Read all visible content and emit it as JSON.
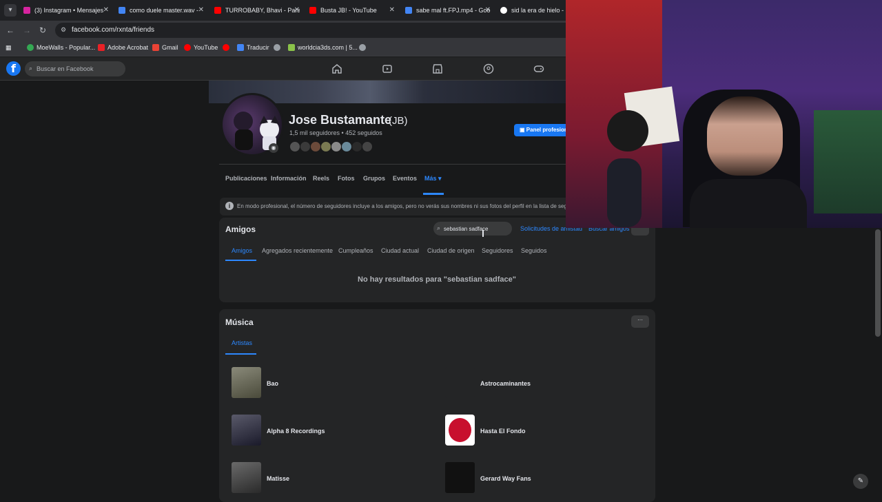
{
  "browser": {
    "tabs": [
      {
        "label": "(3) Instagram • Mensajes",
        "color": "#d6249f"
      },
      {
        "label": "como duele master.wav -",
        "color": "#4285f4"
      },
      {
        "label": "TURROBABY, Bhavi - Para",
        "color": "#ff0000"
      },
      {
        "label": "Busta JB! - YouTube",
        "color": "#ff0000"
      },
      {
        "label": "sabe mal ft.FPJ.mp4 - Goo",
        "color": "#4285f4"
      },
      {
        "label": "sid la era de hielo - Bu",
        "color": "#ffffff"
      }
    ],
    "url": "facebook.com/rxnta/friends",
    "bookmarks": [
      {
        "label": "MoeWalls - Popular...",
        "color": "#34a853"
      },
      {
        "label": "Adobe Acrobat",
        "color": "#ea2126"
      },
      {
        "label": "Gmail",
        "color": "#ea4335"
      },
      {
        "label": "YouTube",
        "color": "#ff0000"
      },
      {
        "label": "",
        "color": "#ff0000"
      },
      {
        "label": "Traducir",
        "color": "#4285f4"
      },
      {
        "label": "",
        "color": "#9aa0a6"
      },
      {
        "label": "worldcia3ds.com | 5...",
        "color": "#8bc34a"
      },
      {
        "label": "",
        "color": "#9aa0a6"
      }
    ]
  },
  "facebook": {
    "logo": "f",
    "search_placeholder": "Buscar en Facebook",
    "nav_icons": [
      "home-icon",
      "video-icon",
      "marketplace-icon",
      "groups-icon",
      "gaming-icon"
    ]
  },
  "profile": {
    "name": "Jose Bustamante",
    "alt_name": "(JB)",
    "stats": "1,5 mil seguidores • 452 seguidos",
    "panel_button": "Panel profesional",
    "tabs": [
      "Publicaciones",
      "Información",
      "Reels",
      "Fotos",
      "Grupos",
      "Eventos",
      "Más ▾"
    ],
    "active_tab": "Más ▾",
    "notice": "En modo profesional, el número de seguidores incluye a los amigos, pero no verás sus nombres ni sus fotos del perfil en la lista de seguidores."
  },
  "friends": {
    "title": "Amigos",
    "search_value": "sebastian sadface",
    "requests_link": "Solicitudes de amistad",
    "find_link": "Buscar amigos",
    "more": "···",
    "tabs": [
      "Amigos",
      "Agregados recientemente",
      "Cumpleaños",
      "Ciudad actual",
      "Ciudad de origen",
      "Seguidores",
      "Seguidos"
    ],
    "empty_message": "No hay resultados para \"sebastian sadface\""
  },
  "music": {
    "title": "Música",
    "more": "···",
    "tab": "Artistas",
    "artists": [
      {
        "name": "Bao"
      },
      {
        "name": "Astrocaminantes"
      },
      {
        "name": "Alpha 8 Recordings"
      },
      {
        "name": "Hasta El Fondo"
      },
      {
        "name": "Matisse"
      },
      {
        "name": "Gerard Way Fans"
      }
    ]
  },
  "colors": {
    "accent": "#2d88ff",
    "facebook_blue": "#1877f2",
    "background": "#18191a",
    "card": "#242526"
  }
}
